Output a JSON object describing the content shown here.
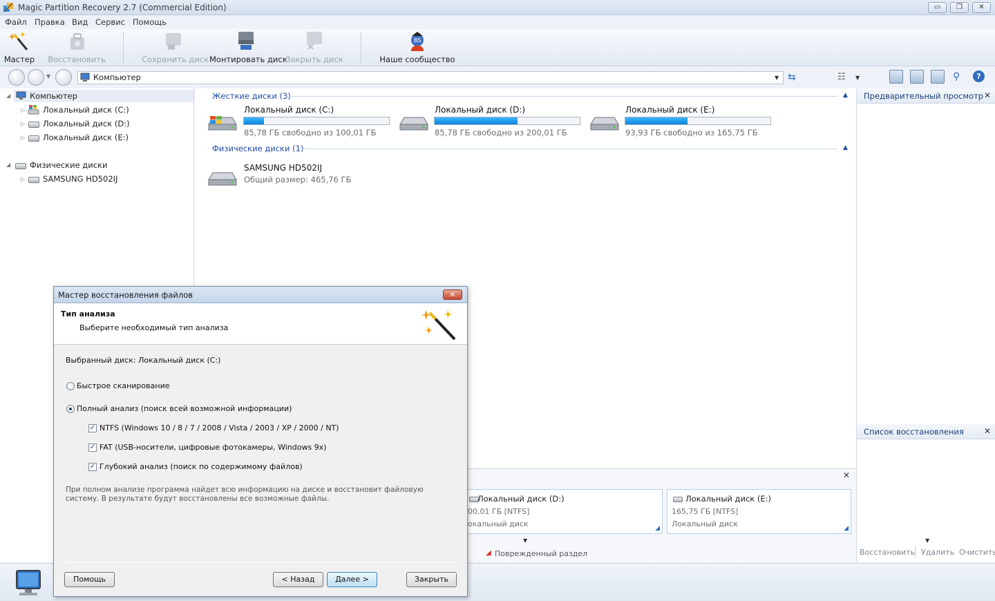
{
  "window": {
    "title": "Magic Partition Recovery 2.7 (Commercial Edition)",
    "minimize_glyph": "▭",
    "maximize_glyph": "❐",
    "close_glyph": "✕"
  },
  "menu": [
    "Файл",
    "Правка",
    "Вид",
    "Сервис",
    "Помощь"
  ],
  "toolbar": {
    "master": "Мастер",
    "restore": "Восстановить",
    "save_disk": "Сохранить диск",
    "mount_disk": "Монтировать диск",
    "close_disk": "Закрыть диск",
    "community": "Наше сообщество"
  },
  "address": {
    "path": "Компьютер"
  },
  "tree": {
    "computer": "Компьютер",
    "drives": [
      "Локальный диск (C:)",
      "Локальный диск (D:)",
      "Локальный диск (E:)"
    ],
    "physical": "Физические диски",
    "physical_items": [
      "SAMSUNG HD502IJ"
    ]
  },
  "main": {
    "hard_disks_header": "Жесткие диски (3)",
    "physical_header": "Физические диски (1)",
    "disks": [
      {
        "name": "Локальный диск (C:)",
        "info": "85,78 ГБ свободно из 100,01 ГБ",
        "used_fraction": 0.14
      },
      {
        "name": "Локальный диск (D:)",
        "info": "85,78 ГБ свободно из 200,01 ГБ",
        "used_fraction": 0.57
      },
      {
        "name": "Локальный диск (E:)",
        "info": "93,93 ГБ свободно из 165,75 ГБ",
        "used_fraction": 0.43
      }
    ],
    "physical_disk": {
      "name": "SAMSUNG HD502IJ",
      "info": "Общий размер: 465,76 ГБ"
    }
  },
  "right_pane": {
    "preview_title": "Предварительный просмотр",
    "recovery_list_title": "Список восстановления",
    "restore_btn": "Восстановить",
    "delete_btn": "Удалить",
    "clear_btn": "Очистить"
  },
  "bottom": {
    "cards": [
      {
        "title": "Локальный диск (D:)",
        "size": "00,01 ГБ [NTFS]",
        "type": "окальный диск"
      },
      {
        "title": "Локальный диск (E:)",
        "size": "165,75 ГБ [NTFS]",
        "type": "Локальный диск"
      }
    ],
    "legend_damaged": "Поврежденный раздел"
  },
  "dialog": {
    "title": "Мастер восстановления файлов",
    "header_title": "Тип анализа",
    "header_subtitle": "Выберите необходимый тип анализа",
    "selected_disk": "Выбранный диск: Локальный диск (C:)",
    "quick_scan": "Быстрое сканирование",
    "full_scan": "Полный анализ (поиск всей возможной информации)",
    "ntfs": "NTFS (Windows 10 / 8 / 7 / 2008 / Vista / 2003 / XP / 2000 / NT)",
    "fat": "FAT (USB-носители, цифровые фотокамеры, Windows 9x)",
    "deep": "Глубокий анализ (поиск по содержимому файлов)",
    "description": "При полном анализе программа найдет всю информацию на диске и восстановит файловую систему. В результате будут восстановлены все возможные файлы.",
    "help_btn": "Помощь",
    "back_btn": "< Назад",
    "next_btn": "Далее >",
    "close_btn": "Закрыть"
  }
}
